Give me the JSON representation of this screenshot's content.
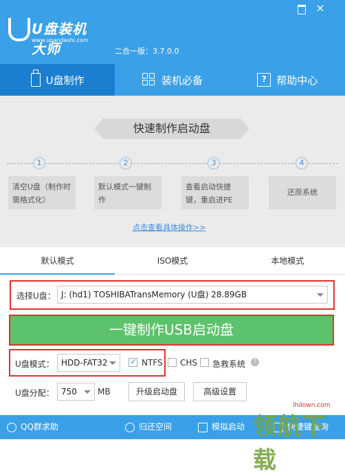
{
  "header": {
    "logo_text": "U盘装机大师",
    "logo_url": "www.upandashi.com",
    "version": "二合一版：3.7.0.0",
    "win_min": "",
    "win_close": "×"
  },
  "nav": {
    "items": [
      {
        "label": "U盘制作",
        "icon": "usb-icon"
      },
      {
        "label": "装机必备",
        "icon": "grid-icon"
      },
      {
        "label": "帮助中心",
        "icon": "help-icon"
      }
    ]
  },
  "panel": {
    "banner": "快速制作启动盘",
    "steps": [
      {
        "num": "1",
        "text": "清空U盘（制作时需格式化）"
      },
      {
        "num": "2",
        "text": "默认模式一键制作"
      },
      {
        "num": "3",
        "text": "查看启动快捷键，重启进PE"
      },
      {
        "num": "4",
        "text": "还原系统"
      }
    ],
    "detail_link": "点击查看具体操作>>"
  },
  "modes": {
    "tabs": [
      "默认模式",
      "ISO模式",
      "本地模式"
    ]
  },
  "form": {
    "select_usb_label": "选择U盘：",
    "select_usb_value": "J: (hd1) TOSHIBATransMemory (U盘) 28.89GB",
    "make_button": "一键制作USB启动盘",
    "usb_mode_label": "U盘模式：",
    "usb_mode_value": "HDD-FAT32",
    "ntfs_label": "NTFS",
    "ntfs_checked": true,
    "chs_label": "CHS",
    "chs_checked": false,
    "rescue_label": "急救系统",
    "rescue_checked": false,
    "help": "?",
    "partition_label": "U盘分配：",
    "partition_value": "750",
    "partition_unit": "MB",
    "upgrade_button": "升级启动盘",
    "advanced_button": "高级设置"
  },
  "footer": {
    "qq": "QQ群求助",
    "restore": "归还空间",
    "simulate": "模拟启动",
    "shortcut": "快捷键查询"
  },
  "watermark": {
    "url": "ihdown.com",
    "text": "领航下载"
  },
  "colors": {
    "header_blue": "#3aa0e8",
    "active_nav": "#1b7fd1",
    "make_green": "#5cc26b",
    "highlight_red": "#e0302e"
  }
}
